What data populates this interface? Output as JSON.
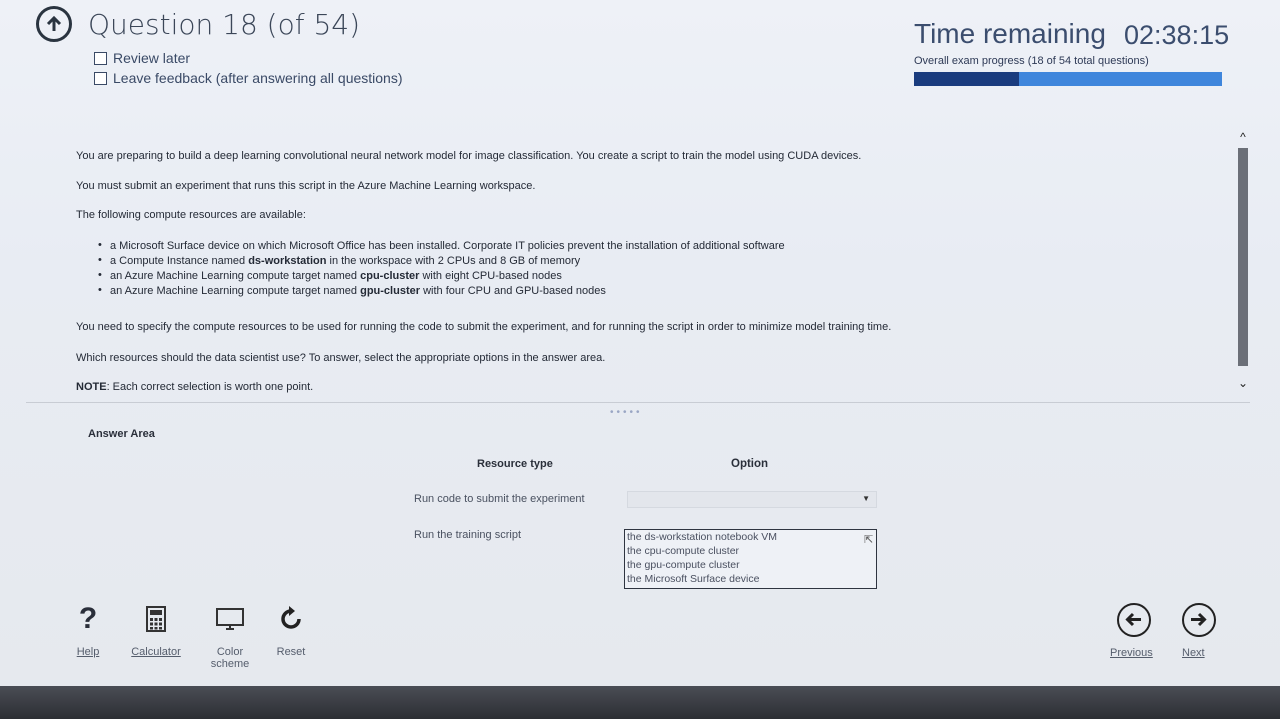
{
  "header": {
    "question_title": "Question 18 (of 54)",
    "review_later": "Review later",
    "leave_feedback": "Leave feedback (after answering all questions)",
    "timer_label": "Time remaining",
    "timer_value": "02:38:15",
    "progress_text": "Overall exam progress (18 of 54 total questions)",
    "progress_fraction": 0.34
  },
  "question": {
    "p1": "You are preparing to build a deep learning convolutional neural network model for image classification. You create a script to train the model using CUDA devices.",
    "p2": "You must submit an experiment that runs this script in the Azure Machine Learning workspace.",
    "p3": "The following compute resources are available:",
    "bullets": [
      {
        "pre": "a Microsoft Surface device on which Microsoft Office has been installed. Corporate IT policies prevent the installation of additional software",
        "bold": "",
        "post": ""
      },
      {
        "pre": "a Compute Instance named ",
        "bold": "ds-workstation",
        "post": " in the workspace with 2 CPUs and 8 GB of memory"
      },
      {
        "pre": "an Azure Machine Learning compute target named ",
        "bold": "cpu-cluster",
        "post": " with eight CPU-based nodes"
      },
      {
        "pre": "an Azure Machine Learning compute target named ",
        "bold": "gpu-cluster",
        "post": " with four CPU and GPU-based nodes"
      }
    ],
    "p4": "You need to specify the compute resources to be used for running the code to submit the experiment, and for running the script in order to minimize model training time.",
    "p5": "Which resources should the data scientist use? To answer, select the appropriate options in the answer area.",
    "note_label": "NOTE",
    "note_text": ": Each correct selection is worth one point."
  },
  "answer": {
    "title": "Answer Area",
    "col_resource": "Resource type",
    "col_option": "Option",
    "row1_label": "Run code to submit the experiment",
    "row1_value": "",
    "row2_label": "Run the training script",
    "row2_options": [
      "the ds-workstation notebook VM",
      "the cpu-compute cluster",
      "the gpu-compute cluster",
      "the Microsoft Surface device"
    ]
  },
  "toolbar": {
    "help": "Help",
    "calculator": "Calculator",
    "color_scheme_1": "Color",
    "color_scheme_2": "scheme",
    "reset": "Reset",
    "previous": "Previous",
    "next": "Next"
  },
  "icons": [
    "back-arrow-icon",
    "help-icon",
    "calculator-icon",
    "monitor-icon",
    "reset-icon",
    "previous-arrow-icon",
    "next-arrow-icon"
  ]
}
